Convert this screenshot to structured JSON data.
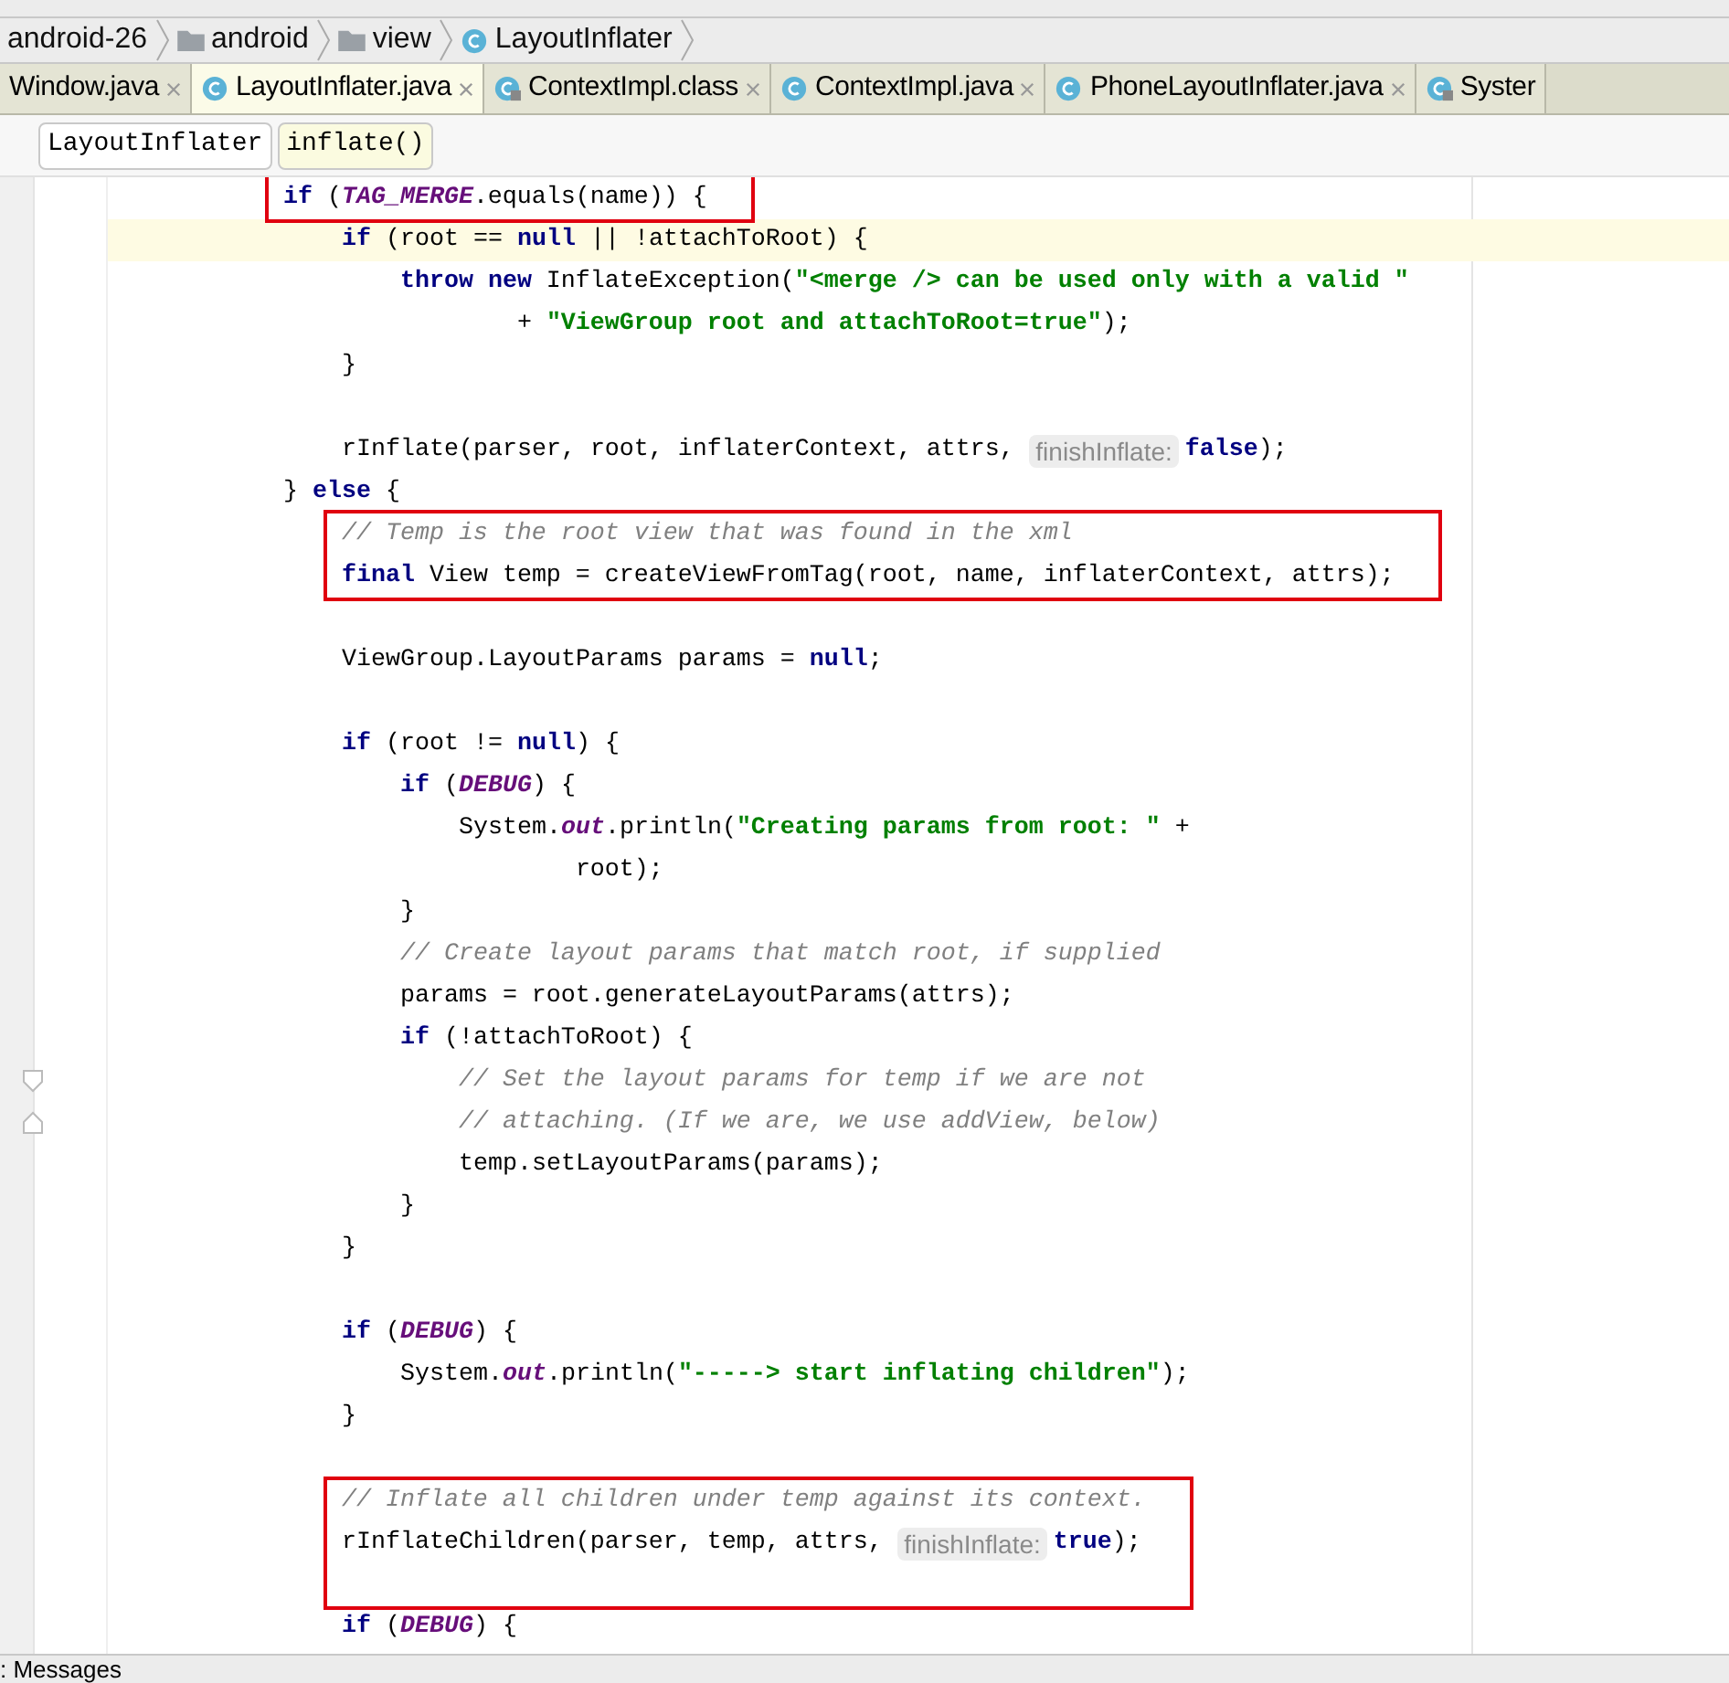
{
  "breadcrumbs": [
    {
      "label": "android-26",
      "kind": "module"
    },
    {
      "label": "android",
      "kind": "folder"
    },
    {
      "label": "view",
      "kind": "folder"
    },
    {
      "label": "LayoutInflater",
      "kind": "class"
    }
  ],
  "tabs": [
    {
      "label": "Window.java",
      "kind": "plain",
      "selected": false,
      "closable": true
    },
    {
      "label": "LayoutInflater.java",
      "kind": "class",
      "selected": true,
      "closable": true
    },
    {
      "label": "ContextImpl.class",
      "kind": "class-locked",
      "selected": false,
      "closable": true
    },
    {
      "label": "ContextImpl.java",
      "kind": "class",
      "selected": false,
      "closable": true
    },
    {
      "label": "PhoneLayoutInflater.java",
      "kind": "class",
      "selected": false,
      "closable": true
    },
    {
      "label": "Syster",
      "kind": "class-locked",
      "selected": false,
      "closable": false
    }
  ],
  "structure_path": [
    {
      "label": "LayoutInflater",
      "selected": false
    },
    {
      "label": "inflate()",
      "selected": true
    }
  ],
  "code": [
    {
      "kind": "line",
      "boxed": true,
      "current": false,
      "tokens": [
        {
          "kind": "kw",
          "text": "if"
        },
        {
          "kind": "plain",
          "text": " ("
        },
        {
          "kind": "const",
          "text": "TAG_MERGE"
        },
        {
          "kind": "plain",
          "text": ".equals(name)) {"
        }
      ],
      "children": [
        {
          "kind": "line",
          "boxed": false,
          "current": true,
          "tokens": [
            {
              "kind": "kw",
              "text": "if"
            },
            {
              "kind": "plain",
              "text": " (root == "
            },
            {
              "kind": "kw",
              "text": "null"
            },
            {
              "kind": "plain",
              "text": " || !attachToRoot) {"
            }
          ],
          "children": [
            {
              "kind": "line",
              "boxed": false,
              "current": false,
              "tokens": [
                {
                  "kind": "kw",
                  "text": "throw new"
                },
                {
                  "kind": "plain",
                  "text": " InflateException("
                },
                {
                  "kind": "str",
                  "text": "\"<merge /> can be used only with a valid \""
                }
              ],
              "continuation": [
                {
                  "kind": "line",
                  "boxed": false,
                  "current": false,
                  "tokens": [
                    {
                      "kind": "plain",
                      "text": "+ "
                    },
                    {
                      "kind": "str",
                      "text": "\"ViewGroup root and attachToRoot=true\""
                    },
                    {
                      "kind": "plain",
                      "text": ");"
                    }
                  ]
                }
              ]
            }
          ]
        },
        {
          "kind": "line",
          "boxed": false,
          "current": false,
          "tokens": [
            {
              "kind": "plain",
              "text": "}"
            }
          ]
        },
        {
          "kind": "blank",
          "boxed": false,
          "current": false
        },
        {
          "kind": "line",
          "boxed": false,
          "current": false,
          "tokens": [
            {
              "kind": "plain",
              "text": "rInflate(parser, root, inflaterContext, attrs,"
            },
            {
              "kind": "hint",
              "text": "finishInflate:"
            },
            {
              "kind": "kw",
              "text": "false"
            },
            {
              "kind": "plain",
              "text": ");"
            }
          ]
        }
      ]
    },
    {
      "kind": "line",
      "boxed": false,
      "current": false,
      "tokens": [
        {
          "kind": "plain",
          "text": "} "
        },
        {
          "kind": "kw",
          "text": "else"
        },
        {
          "kind": "plain",
          "text": " {"
        }
      ],
      "children": [
        {
          "kind": "line",
          "boxed": true,
          "current": false,
          "tokens": [
            {
              "kind": "comment",
              "text": "// Temp is the root view that was found in the xml"
            }
          ]
        },
        {
          "kind": "line",
          "boxed": true,
          "current": false,
          "tokens": [
            {
              "kind": "kw",
              "text": "final"
            },
            {
              "kind": "plain",
              "text": " View temp = createViewFromTag(root, name, inflaterContext, attrs);"
            }
          ]
        },
        {
          "kind": "blank",
          "boxed": false,
          "current": false
        },
        {
          "kind": "line",
          "boxed": false,
          "current": false,
          "tokens": [
            {
              "kind": "plain",
              "text": "ViewGroup.LayoutParams params = "
            },
            {
              "kind": "kw",
              "text": "null"
            },
            {
              "kind": "plain",
              "text": ";"
            }
          ]
        },
        {
          "kind": "blank",
          "boxed": false,
          "current": false
        },
        {
          "kind": "line",
          "boxed": false,
          "current": false,
          "tokens": [
            {
              "kind": "kw",
              "text": "if"
            },
            {
              "kind": "plain",
              "text": " (root != "
            },
            {
              "kind": "kw",
              "text": "null"
            },
            {
              "kind": "plain",
              "text": ") {"
            }
          ],
          "children": [
            {
              "kind": "line",
              "boxed": false,
              "current": false,
              "tokens": [
                {
                  "kind": "kw",
                  "text": "if"
                },
                {
                  "kind": "plain",
                  "text": " ("
                },
                {
                  "kind": "const",
                  "text": "DEBUG"
                },
                {
                  "kind": "plain",
                  "text": ") {"
                }
              ],
              "children": [
                {
                  "kind": "line",
                  "boxed": false,
                  "current": false,
                  "tokens": [
                    {
                      "kind": "plain",
                      "text": "System."
                    },
                    {
                      "kind": "const",
                      "text": "out"
                    },
                    {
                      "kind": "plain",
                      "text": ".println("
                    },
                    {
                      "kind": "str",
                      "text": "\"Creating params from root: \""
                    },
                    {
                      "kind": "plain",
                      "text": " +"
                    }
                  ],
                  "continuation": [
                    {
                      "kind": "line",
                      "boxed": false,
                      "current": false,
                      "tokens": [
                        {
                          "kind": "plain",
                          "text": "root);"
                        }
                      ]
                    }
                  ]
                }
              ]
            },
            {
              "kind": "line",
              "boxed": false,
              "current": false,
              "tokens": [
                {
                  "kind": "plain",
                  "text": "}"
                }
              ]
            },
            {
              "kind": "line",
              "boxed": false,
              "current": false,
              "tokens": [
                {
                  "kind": "comment",
                  "text": "// Create layout params that match root, if supplied"
                }
              ]
            },
            {
              "kind": "line",
              "boxed": false,
              "current": false,
              "tokens": [
                {
                  "kind": "plain",
                  "text": "params = root.generateLayoutParams(attrs);"
                }
              ]
            },
            {
              "kind": "line",
              "boxed": false,
              "current": false,
              "tokens": [
                {
                  "kind": "kw",
                  "text": "if"
                },
                {
                  "kind": "plain",
                  "text": " (!attachToRoot) {"
                }
              ],
              "children": [
                {
                  "kind": "line",
                  "boxed": false,
                  "current": false,
                  "tokens": [
                    {
                      "kind": "comment",
                      "text": "// Set the layout params for temp if we are not"
                    }
                  ]
                },
                {
                  "kind": "line",
                  "boxed": false,
                  "current": false,
                  "tokens": [
                    {
                      "kind": "comment",
                      "text": "// attaching. (If we are, we use addView, below)"
                    }
                  ]
                },
                {
                  "kind": "line",
                  "boxed": false,
                  "current": false,
                  "tokens": [
                    {
                      "kind": "plain",
                      "text": "temp.setLayoutParams(params);"
                    }
                  ]
                }
              ]
            },
            {
              "kind": "line",
              "boxed": false,
              "current": false,
              "tokens": [
                {
                  "kind": "plain",
                  "text": "}"
                }
              ]
            }
          ]
        },
        {
          "kind": "line",
          "boxed": false,
          "current": false,
          "tokens": [
            {
              "kind": "plain",
              "text": "}"
            }
          ]
        },
        {
          "kind": "blank",
          "boxed": false,
          "current": false
        },
        {
          "kind": "line",
          "boxed": false,
          "current": false,
          "tokens": [
            {
              "kind": "kw",
              "text": "if"
            },
            {
              "kind": "plain",
              "text": " ("
            },
            {
              "kind": "const",
              "text": "DEBUG"
            },
            {
              "kind": "plain",
              "text": ") {"
            }
          ],
          "children": [
            {
              "kind": "line",
              "boxed": false,
              "current": false,
              "tokens": [
                {
                  "kind": "plain",
                  "text": "System."
                },
                {
                  "kind": "const",
                  "text": "out"
                },
                {
                  "kind": "plain",
                  "text": ".println("
                },
                {
                  "kind": "str",
                  "text": "\"-----> start inflating children\""
                },
                {
                  "kind": "plain",
                  "text": ");"
                }
              ]
            }
          ]
        },
        {
          "kind": "line",
          "boxed": false,
          "current": false,
          "tokens": [
            {
              "kind": "plain",
              "text": "}"
            }
          ]
        },
        {
          "kind": "blank",
          "boxed": false,
          "current": false
        },
        {
          "kind": "line",
          "boxed": true,
          "current": false,
          "tokens": [
            {
              "kind": "comment",
              "text": "// Inflate all children under temp against its context."
            }
          ]
        },
        {
          "kind": "line",
          "boxed": true,
          "current": false,
          "tokens": [
            {
              "kind": "plain",
              "text": "rInflateChildren(parser, temp, attrs,"
            },
            {
              "kind": "hint",
              "text": "finishInflate:"
            },
            {
              "kind": "kw",
              "text": "true"
            },
            {
              "kind": "plain",
              "text": ");"
            }
          ]
        },
        {
          "kind": "blank",
          "boxed": true,
          "current": false
        },
        {
          "kind": "line",
          "boxed": false,
          "current": false,
          "tokens": [
            {
              "kind": "kw",
              "text": "if"
            },
            {
              "kind": "plain",
              "text": " ("
            },
            {
              "kind": "const",
              "text": "DEBUG"
            },
            {
              "kind": "plain",
              "text": ") {"
            }
          ]
        }
      ]
    }
  ],
  "bottom_panel": {
    "label": ": Messages"
  }
}
